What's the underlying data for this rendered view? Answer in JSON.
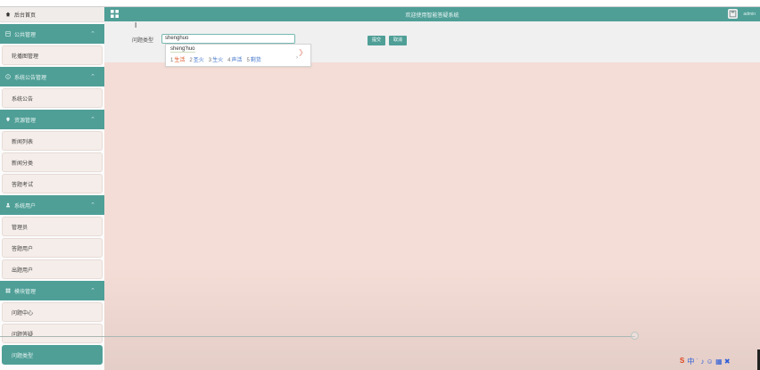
{
  "header": {
    "title": "欢迎使用智能答疑系统",
    "user": "admin"
  },
  "sidebar": {
    "home": "后台首页",
    "groups": [
      {
        "label": "公共管理",
        "items": [
          "轮播图管理"
        ]
      },
      {
        "label": "系统公告管理",
        "items": [
          "系统公告"
        ]
      },
      {
        "label": "资源管理",
        "items": [
          "新闻列表",
          "新闻分类",
          "答题考试"
        ]
      },
      {
        "label": "系统用户",
        "items": [
          "管理员",
          "答题用户",
          "出题用户"
        ]
      },
      {
        "label": "模块管理",
        "items": [
          "问题中心",
          "问题答疑",
          "问题类型"
        ]
      }
    ]
  },
  "form": {
    "label": "问题类型",
    "value": "shenghuo",
    "submit": "提交",
    "cancel": "取消"
  },
  "ime": {
    "composition": "sheng'huo",
    "candidates": [
      {
        "num": "1",
        "text": "生活"
      },
      {
        "num": "2",
        "text": "圣火"
      },
      {
        "num": "3",
        "text": "生火"
      },
      {
        "num": "4",
        "text": "声活"
      },
      {
        "num": "5",
        "text": "剩货"
      }
    ],
    "next": "›"
  },
  "tray": {
    "s_label": "S",
    "items": "中 ˙ ♪ ☺ ▦ ✖"
  },
  "colors": {
    "accent": "#4f9f97",
    "bg": "#f4ddd6",
    "toolbar": "#f0f0f0"
  }
}
